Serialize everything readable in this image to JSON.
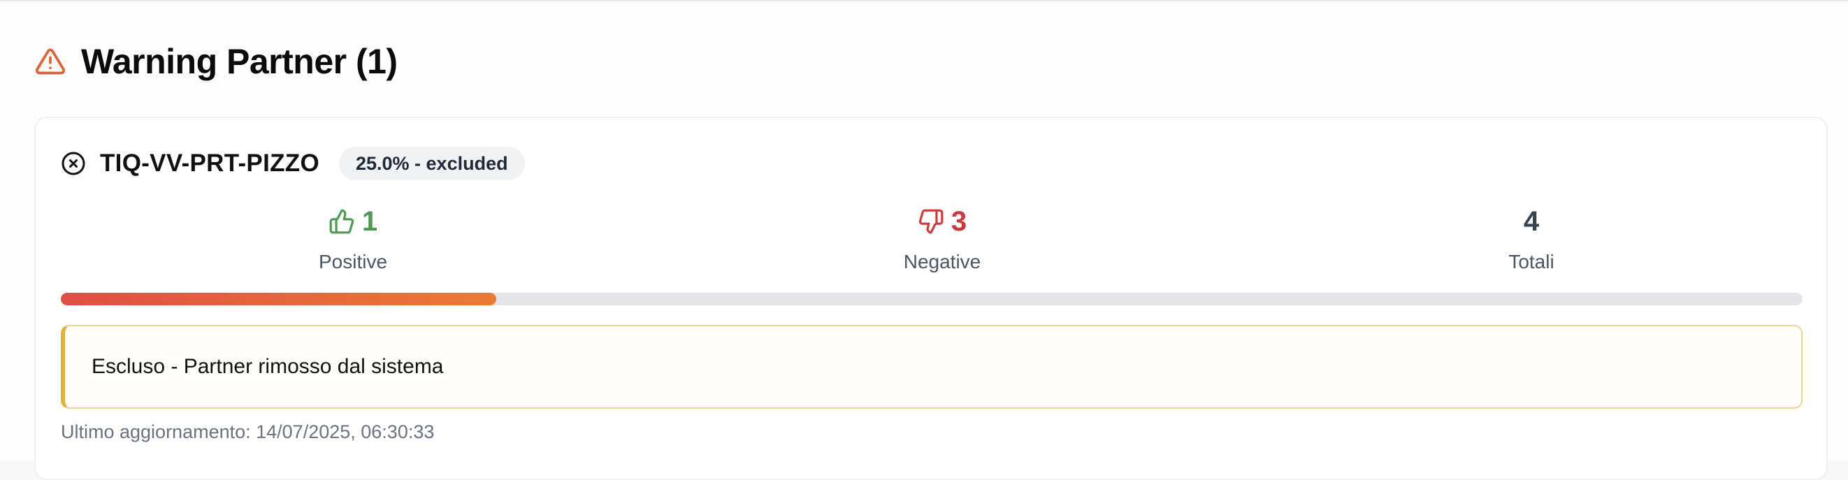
{
  "section": {
    "icon": "warning-triangle-icon",
    "title": "Warning Partner (1)"
  },
  "partner": {
    "status_icon": "close-circle-icon",
    "name": "TIQ-VV-PRT-PIZZO",
    "badge": "25.0% - excluded",
    "stats": {
      "positive": {
        "icon": "thumbs-up-icon",
        "value": "1",
        "label": "Positive"
      },
      "negative": {
        "icon": "thumbs-down-icon",
        "value": "3",
        "label": "Negative"
      },
      "total": {
        "value": "4",
        "label": "Totali"
      }
    },
    "progress_fraction": 0.25,
    "alert": "Escluso - Partner rimosso dal sistema",
    "last_update": "Ultimo aggiornamento: 14/07/2025, 06:30:33"
  },
  "colors": {
    "warning_icon": "#e0612f",
    "positive": "#4c9a4f",
    "negative": "#d0383a",
    "progress_start": "#df4f46",
    "progress_end": "#ea7a34",
    "alert_border": "#e2b13a"
  }
}
